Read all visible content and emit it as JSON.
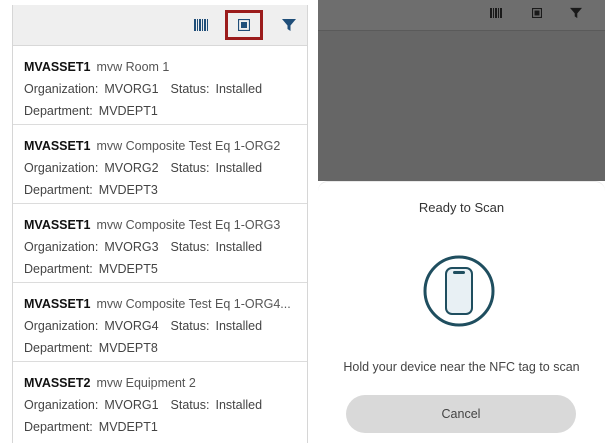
{
  "left_panel": {
    "toolbar": {
      "barcode_icon": "barcode-scan-icon",
      "nfc_icon": "nfc-scan-icon",
      "filter_icon": "filter-icon",
      "highlight_color": "#9b1c1c",
      "accent_color": "#1f4e79"
    },
    "items": [
      {
        "code": "MVASSET1",
        "title": "mvw Room 1",
        "org_label": "Organization:",
        "org": "MVORG1",
        "status_label": "Status:",
        "status": "Installed",
        "dept_label": "Department:",
        "dept": "MVDEPT1"
      },
      {
        "code": "MVASSET1",
        "title": "mvw Composite Test Eq 1-ORG2",
        "org_label": "Organization:",
        "org": "MVORG2",
        "status_label": "Status:",
        "status": "Installed",
        "dept_label": "Department:",
        "dept": "MVDEPT3"
      },
      {
        "code": "MVASSET1",
        "title": "mvw Composite Test Eq 1-ORG3",
        "org_label": "Organization:",
        "org": "MVORG3",
        "status_label": "Status:",
        "status": "Installed",
        "dept_label": "Department:",
        "dept": "MVDEPT5"
      },
      {
        "code": "MVASSET1",
        "title": "mvw Composite Test Eq 1-ORG4...",
        "org_label": "Organization:",
        "org": "MVORG4",
        "status_label": "Status:",
        "status": "Installed",
        "dept_label": "Department:",
        "dept": "MVDEPT8"
      },
      {
        "code": "MVASSET2",
        "title": "mvw Equipment 2",
        "org_label": "Organization:",
        "org": "MVORG1",
        "status_label": "Status:",
        "status": "Installed",
        "dept_label": "Department:",
        "dept": "MVDEPT1"
      }
    ]
  },
  "right_panel": {
    "sheet": {
      "title": "Ready to Scan",
      "phone_icon": "phone-icon",
      "message": "Hold your device near the NFC tag to scan",
      "cancel_label": "Cancel"
    }
  }
}
